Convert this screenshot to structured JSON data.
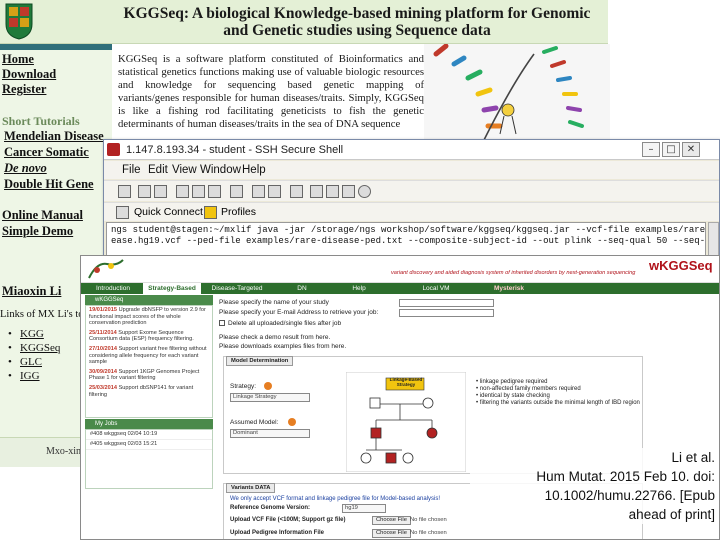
{
  "site": {
    "title": "KGGSeq: A biological Knowledge-based mining platform for Genomic and Genetic studies using Sequence data",
    "description": "KGGSeq is a software platform constituted of Bioinformatics and statistical genetics functions making use of valuable biologic resources and knowledge for sequencing based genetic mapping of variants/genes responsible for human diseases/traits. Simply, KGGSeq is like a fishing rod facilitating geneticists to fish the genetic determinants of human diseases/traits in the sea of DNA sequence",
    "nav": {
      "home": "Home",
      "download": "Download",
      "register": "Register",
      "short_tutorials": "Short Tutorials",
      "mendelian_disease": "Mendelian Disease",
      "cancer_somatic": "Cancer Somatic",
      "de_novo": "De novo",
      "double_hit_gene": "Double Hit Gene",
      "online_manual": "Online Manual",
      "simple_demo": "Simple Demo",
      "author": "Miaoxin Li"
    },
    "links_heading": "Links of MX Li's tools",
    "links": [
      "KGG",
      "KGGSeq",
      "GLC",
      "IGG"
    ],
    "footer_text": "Mxo-xin"
  },
  "ssh": {
    "title": "1.147.8.193.34 - student - SSH Secure Shell",
    "controls": {
      "minimize": "–",
      "maximize": "□",
      "close": "✕"
    },
    "menu": [
      "File",
      "Edit",
      "View",
      "Window",
      "Help"
    ],
    "quick_connect": "Quick Connect",
    "profiles": "Profiles",
    "terminal_lines": [
      "ngs student@stagen:~/mxlif java -jar /storage/ngs workshop/software/kggseq/kggseq.jar --vcf-file examples/rare",
      "ease.hg19.vcf --ped-file examples/rare-disease-ped.txt --composite-subject-id --out plink --seq-qual 50 --seq-m"
    ]
  },
  "wk": {
    "brand": "wKGGSeq",
    "tagline": "variant discovery and aided diagnosis system of inherited disorders by next-generation sequencing",
    "tabs": [
      "Introduction",
      "Strategy-Based",
      "Disease-Targeted",
      "DN",
      "Help",
      "Local VM",
      "Mysterisk"
    ],
    "news_title": "wKGGSeq",
    "news": [
      {
        "date": "19/01/2015",
        "text": "Upgrade dbNSFP to version 2.9 for functional impact scores of the whole conservation prediction"
      },
      {
        "date": "25/11/2014",
        "text": "Support Exome Sequence Consortium data (ESP) frequency filtering."
      },
      {
        "date": "27/10/2014",
        "text": "Support variant free filtering without considering allele frequency for each variant sample"
      },
      {
        "date": "30/09/2014",
        "text": "Support 1KGP Genomes Project Phase 1 for variant filtering"
      },
      {
        "date": "25/03/2014",
        "text": "Support dbSNP141 for variant filtering"
      }
    ],
    "jobs_title": "My Jobs",
    "jobs": [
      "#408 wkggseq 02/04 10:19",
      "#405 wkggseq 02/03 15:21"
    ],
    "form": {
      "study_name": "Please specify the name of your study",
      "email": "Please specify your E-mail Address to retrieve your job:",
      "delete_files": "Delete all uploaded/single files after job",
      "demo_result": "Please check a demo result from here.",
      "download_examples": "Please downloads examples files from here."
    },
    "model_tab": "Model Determination",
    "strategy_label": "Strategy:",
    "strategy_value": "Linkage Strategy",
    "inheritance_label": "Assumed Model:",
    "inheritance_value": "Dominant",
    "pedigree_label": "Linkage-Based Strategy",
    "bullets": [
      "linkage pedigree required",
      "non-affected family members required",
      "identical by state checking",
      "filtering the variants outside the minimal length of IBD region"
    ],
    "variants_tab": "Variants DATA",
    "variants_note": "We only accept VCF format and linkage pedigree file for Model-based analysis!",
    "ref_genome_label": "Reference Genome Version:",
    "ref_genome_value": "hg19",
    "upload_vcf": "Upload VCF File (<100M; Support gz file)",
    "upload_ped": "Upload Pedigree Information File",
    "choose_file": "Choose File",
    "no_file": "No file chosen"
  },
  "citation": {
    "line1": "Li et al.",
    "line2": "Hum Mutat. 2015 Feb 10. doi:",
    "line3": "10.1002/humu.22766. [Epub",
    "line4": "ahead of print]"
  }
}
